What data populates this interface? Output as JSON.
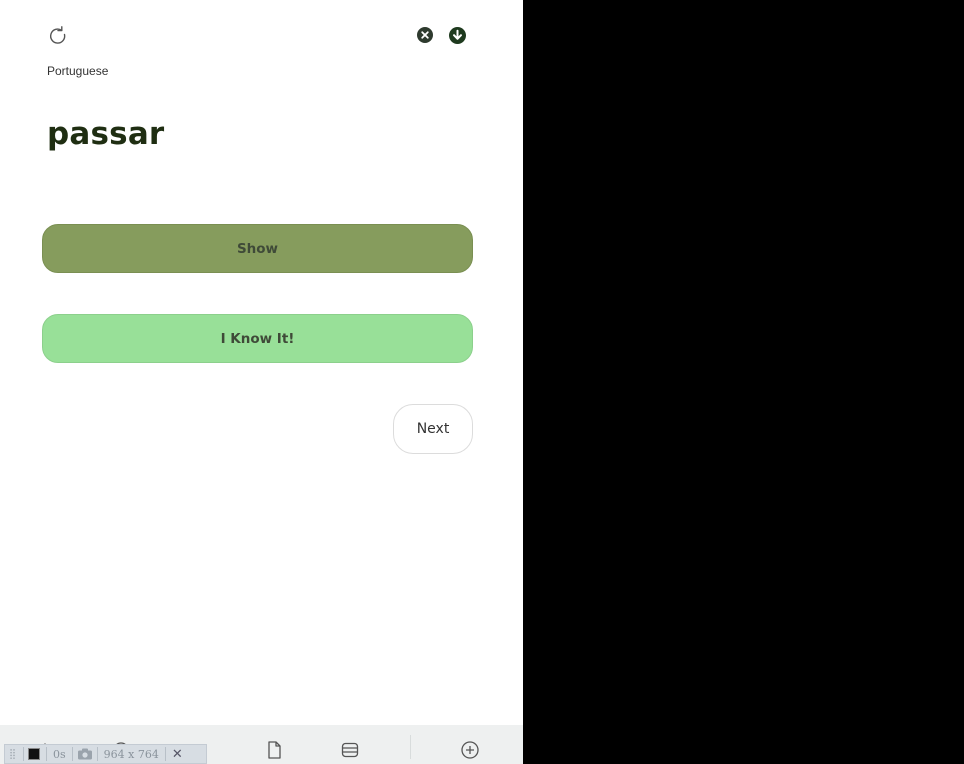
{
  "card": {
    "language": "Portuguese",
    "word": "passar"
  },
  "actions": {
    "show_label": "Show",
    "know_label": "I Know It!",
    "next_label": "Next"
  },
  "icons": {
    "refresh": "refresh-icon",
    "close": "close-circle-icon",
    "download": "download-circle-icon"
  },
  "bottom_bar": {
    "items": [
      "home-icon",
      "info-icon",
      "menu-icon",
      "document-icon",
      "list-icon",
      "add-circle-icon"
    ]
  },
  "recorder": {
    "elapsed": "0s",
    "size": "964 x 764"
  },
  "colors": {
    "show_button": "#869c5d",
    "know_button": "#98e098",
    "word_text": "#1f2e12",
    "dark_green_icon": "#1e3a1e"
  }
}
